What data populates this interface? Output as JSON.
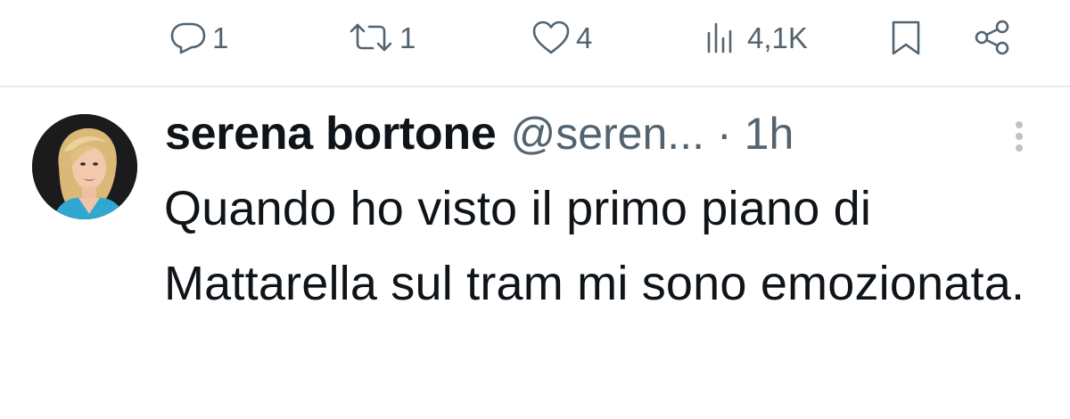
{
  "actions": {
    "reply": {
      "icon": "reply-icon",
      "count": "1"
    },
    "retweet": {
      "icon": "retweet-icon",
      "count": "1"
    },
    "like": {
      "icon": "heart-icon",
      "count": "4"
    },
    "views": {
      "icon": "views-icon",
      "count": "4,1K"
    },
    "bookmark": {
      "icon": "bookmark-icon"
    },
    "share": {
      "icon": "share-icon"
    }
  },
  "tweet": {
    "display_name": "serena bortone",
    "handle": "@seren...",
    "separator": "·",
    "time": "1h",
    "text": "Quando ho visto il primo piano di Mattarella sul tram mi sono emozionata."
  },
  "colors": {
    "text_primary": "#0f1419",
    "text_secondary": "#536471",
    "divider": "#e6e9ec",
    "more_dots": "#b9c3cc"
  }
}
